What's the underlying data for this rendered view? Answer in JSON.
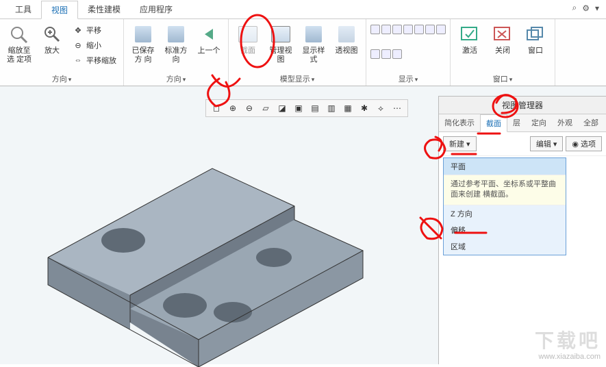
{
  "tabs": {
    "tools": "工具",
    "view": "视图",
    "flex": "柔性建模",
    "app": "应用程序"
  },
  "top_right": {
    "search_icon": "⌕",
    "gear_icon": "⚙",
    "dd": "▾"
  },
  "ribbon": {
    "g1": {
      "restore_zoom": "缩放至选\n定项",
      "zoom": "放大",
      "pan": "平移",
      "shrink": "缩小",
      "panzoom": "平移缩放",
      "label": "方向"
    },
    "g2": {
      "saved": "已保存方\n向",
      "std": "标准方向",
      "prev": "上一个",
      "label": "方向"
    },
    "g3": {
      "section": "截面",
      "manage": "管理视图",
      "style": "显示样式",
      "persp": "透视图",
      "label": "模型显示"
    },
    "g4": {
      "label": "显示"
    },
    "g5": {
      "activate": "激活",
      "close": "关闭",
      "window": "窗口",
      "label": "窗口"
    }
  },
  "rpanel": {
    "title": "视图管理器",
    "tabs": {
      "simple": "简化表示",
      "section": "截面",
      "layer": "层",
      "orient": "定向",
      "appear": "外观",
      "all": "全部"
    },
    "new_btn": "新建",
    "edit_btn": "编辑",
    "options_btn": "选项",
    "dropdown": {
      "plane": "平面",
      "desc": "通过参考平面、坐标系或平整曲面来创建\n横截面。",
      "zdir": "Z 方向",
      "offset": "偏移",
      "region": "区域"
    }
  },
  "watermark": {
    "logo": "下载吧",
    "url": "www.xiazaiba.com"
  }
}
